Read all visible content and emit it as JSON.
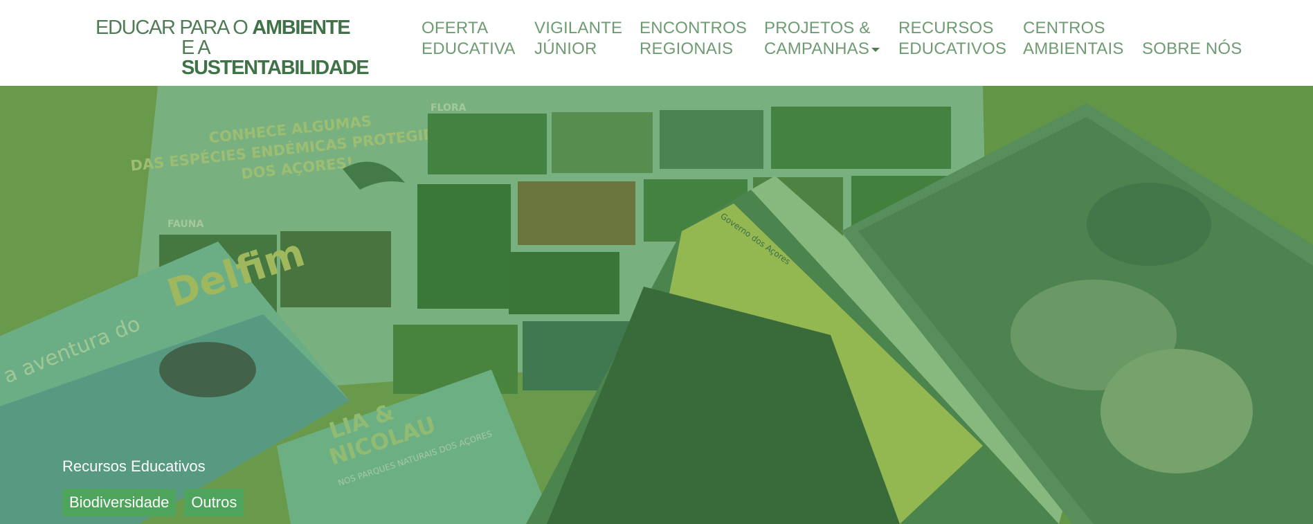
{
  "logo": {
    "line1_regular": "EDUCAR PARA O ",
    "line1_bold": "AMBIENTE",
    "line2_regular": "E A ",
    "line2_bold": "SUSTENTABILIDADE"
  },
  "nav": [
    {
      "line1": "OFERTA",
      "line2": "EDUCATIVA",
      "has_dropdown": false
    },
    {
      "line1": "VIGILANTE",
      "line2": "JÚNIOR",
      "has_dropdown": false
    },
    {
      "line1": "ENCONTROS",
      "line2": "REGIONAIS",
      "has_dropdown": false
    },
    {
      "line1": "PROJETOS &",
      "line2": "CAMPANHAS",
      "has_dropdown": true
    },
    {
      "line1": "RECURSOS",
      "line2": "EDUCATIVOS",
      "has_dropdown": false
    },
    {
      "line1": "CENTROS",
      "line2": "AMBIENTAIS",
      "has_dropdown": false
    },
    {
      "line1": "",
      "line2": "SOBRE NÓS",
      "has_dropdown": false
    }
  ],
  "hero": {
    "caption": "Recursos Educativos",
    "tags": [
      "Biodiversidade",
      "Outros"
    ],
    "poster_title_1": "CONHECE ALGUMAS",
    "poster_title_2": "DAS ESPÉCIES ENDÉMICAS PROTEGIDAS",
    "poster_title_3": "DOS AÇORES!",
    "poster_flora": "FLORA",
    "poster_fauna": "FAUNA",
    "book1_title": "Delfim",
    "book1_prefix": "a aventura do",
    "book2_title_1": "LIA &",
    "book2_title_2": "NICOLAU",
    "book2_subtitle": "NOS PARQUES NATURAIS DOS AÇORES",
    "poster3_brand": "Governo dos Açores"
  },
  "colors": {
    "logo": "#3f7247",
    "nav_text": "#6e9b72",
    "tag_bg": "#4ea35d",
    "hero_overlay": "#4e8c46"
  }
}
